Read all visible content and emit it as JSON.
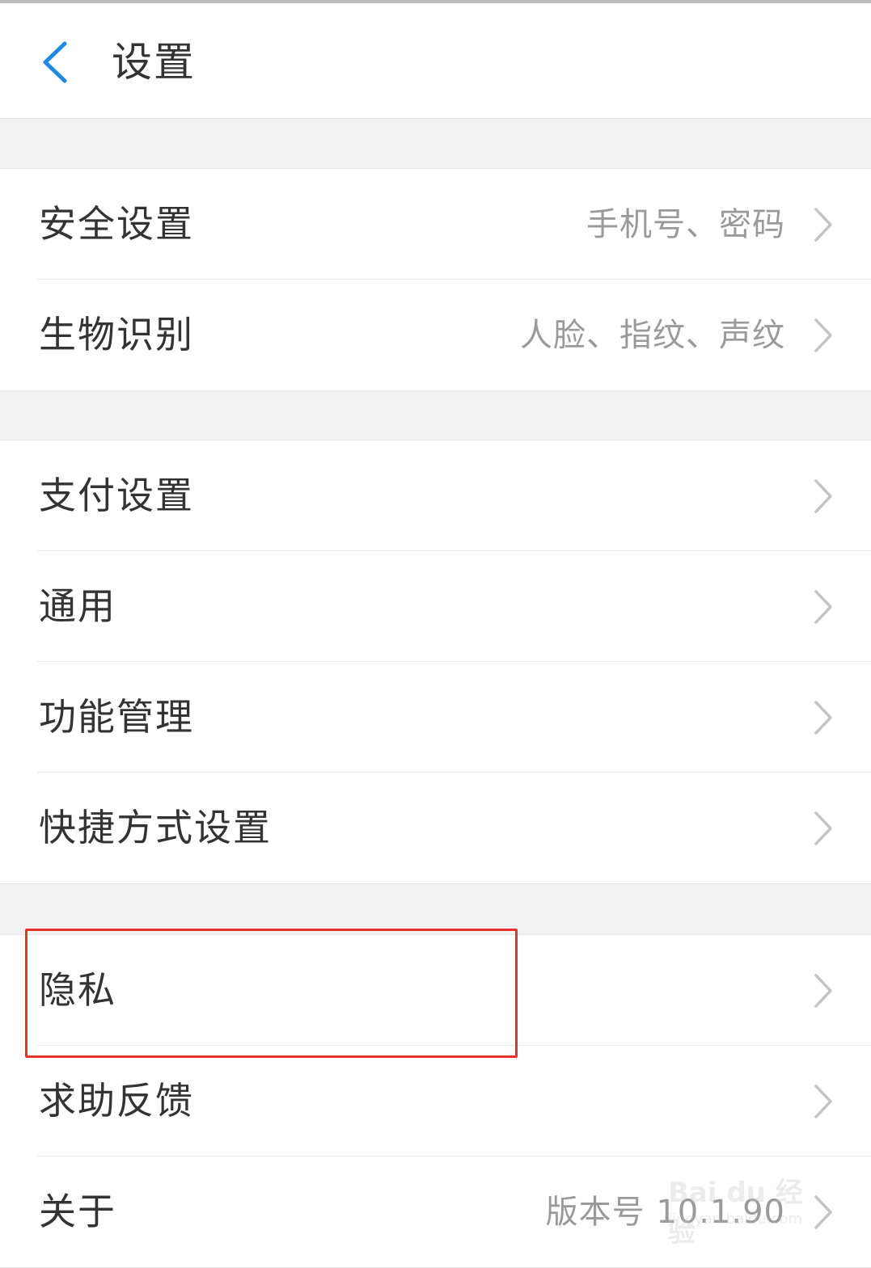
{
  "header": {
    "title": "设置",
    "back_icon": "chevron-left-icon",
    "accent_color": "#1e88e5"
  },
  "groups": [
    {
      "items": [
        {
          "label": "安全设置",
          "value": "手机号、密码"
        },
        {
          "label": "生物识别",
          "value": "人脸、指纹、声纹"
        }
      ]
    },
    {
      "items": [
        {
          "label": "支付设置",
          "value": ""
        },
        {
          "label": "通用",
          "value": ""
        },
        {
          "label": "功能管理",
          "value": ""
        },
        {
          "label": "快捷方式设置",
          "value": ""
        }
      ]
    },
    {
      "items": [
        {
          "label": "隐私",
          "value": ""
        },
        {
          "label": "求助反馈",
          "value": ""
        },
        {
          "label": "关于",
          "value": "版本号 10.1.90"
        }
      ]
    }
  ],
  "highlight": {
    "target": "隐私",
    "color": "#e5322d"
  },
  "watermark": {
    "brand": "Bai du 经验",
    "url": "jingyan.baidu.com"
  }
}
